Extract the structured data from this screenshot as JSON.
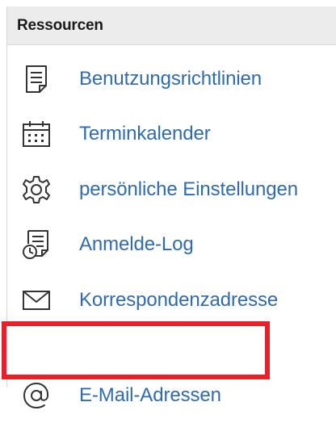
{
  "panel": {
    "title": "Ressourcen",
    "items": [
      {
        "label": "Benutzungsrichtlinien",
        "icon": "document-icon"
      },
      {
        "label": "Terminkalender",
        "icon": "calendar-icon"
      },
      {
        "label": "persönliche Einstellungen",
        "icon": "gear-icon"
      },
      {
        "label": "Anmelde-Log",
        "icon": "document-clock-icon"
      },
      {
        "label": "Korrespondenzadresse",
        "icon": "envelope-icon"
      },
      {
        "label": "E-Mail-Adressen",
        "icon": "at-sign-icon"
      }
    ]
  },
  "highlight": {
    "target": "E-Mail-Adressen",
    "color": "#e8202a"
  },
  "colors": {
    "link": "#2e6bb0",
    "header_bg": "#ececec"
  }
}
